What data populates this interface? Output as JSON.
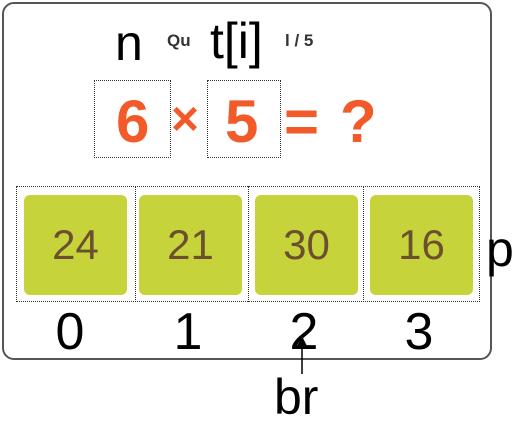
{
  "header": {
    "n_label": "n",
    "qu_label": "Qu",
    "t_label": "t[i]",
    "count_label": "l / 5"
  },
  "question": {
    "operand_a": "6",
    "operator": "×",
    "operand_b": "5",
    "equals": "=",
    "unknown": "?"
  },
  "answers": {
    "values": [
      "24",
      "21",
      "30",
      "16"
    ],
    "indices": [
      "0",
      "1",
      "2",
      "3"
    ]
  },
  "side_label": "p",
  "pointer_label": "br",
  "colors": {
    "question_text": "#f25a2a",
    "tile_fill": "#c7d33a",
    "tile_text": "#6b5030",
    "card_border": "#555555"
  }
}
